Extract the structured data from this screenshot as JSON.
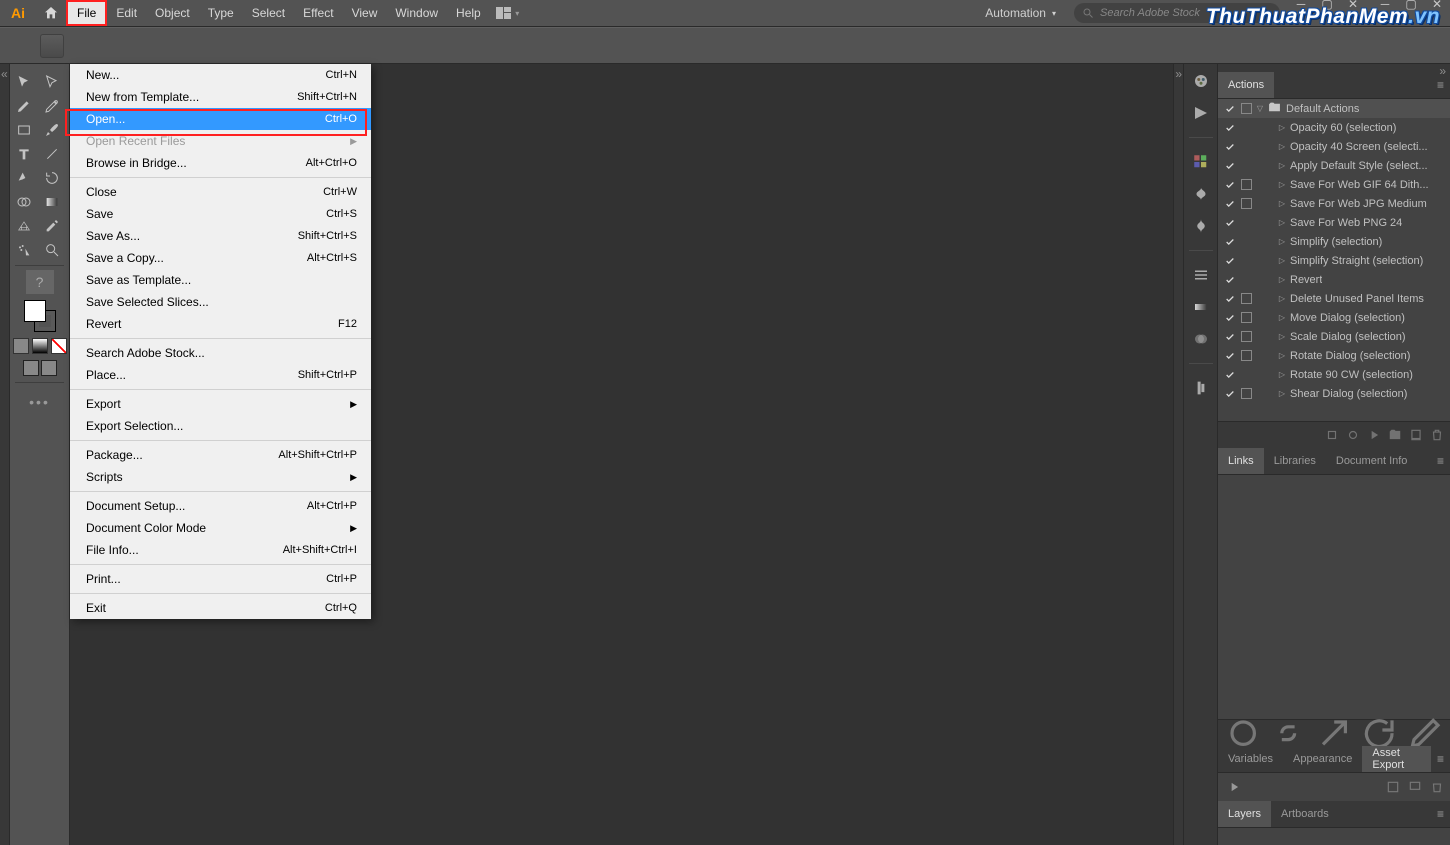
{
  "menubar": {
    "items": [
      "File",
      "Edit",
      "Object",
      "Type",
      "Select",
      "Effect",
      "View",
      "Window",
      "Help"
    ],
    "active": "File"
  },
  "workspace": {
    "label": "Automation"
  },
  "search": {
    "placeholder": "Search Adobe Stock"
  },
  "dropdown": {
    "groups": [
      [
        {
          "label": "New...",
          "shortcut": "Ctrl+N"
        },
        {
          "label": "New from Template...",
          "shortcut": "Shift+Ctrl+N"
        },
        {
          "label": "Open...",
          "shortcut": "Ctrl+O",
          "highlighted": true
        },
        {
          "label": "Open Recent Files",
          "sub": true,
          "disabled": true
        },
        {
          "label": "Browse in Bridge...",
          "shortcut": "Alt+Ctrl+O"
        }
      ],
      [
        {
          "label": "Close",
          "shortcut": "Ctrl+W"
        },
        {
          "label": "Save",
          "shortcut": "Ctrl+S"
        },
        {
          "label": "Save As...",
          "shortcut": "Shift+Ctrl+S"
        },
        {
          "label": "Save a Copy...",
          "shortcut": "Alt+Ctrl+S"
        },
        {
          "label": "Save as Template..."
        },
        {
          "label": "Save Selected Slices..."
        },
        {
          "label": "Revert",
          "shortcut": "F12"
        }
      ],
      [
        {
          "label": "Search Adobe Stock..."
        },
        {
          "label": "Place...",
          "shortcut": "Shift+Ctrl+P"
        }
      ],
      [
        {
          "label": "Export",
          "sub": true
        },
        {
          "label": "Export Selection..."
        }
      ],
      [
        {
          "label": "Package...",
          "shortcut": "Alt+Shift+Ctrl+P"
        },
        {
          "label": "Scripts",
          "sub": true
        }
      ],
      [
        {
          "label": "Document Setup...",
          "shortcut": "Alt+Ctrl+P"
        },
        {
          "label": "Document Color Mode",
          "sub": true
        },
        {
          "label": "File Info...",
          "shortcut": "Alt+Shift+Ctrl+I"
        }
      ],
      [
        {
          "label": "Print...",
          "shortcut": "Ctrl+P"
        }
      ],
      [
        {
          "label": "Exit",
          "shortcut": "Ctrl+Q"
        }
      ]
    ]
  },
  "actions_panel": {
    "tab": "Actions",
    "folder": "Default Actions",
    "items": [
      {
        "name": "Opacity 60 (selection)",
        "sq": false
      },
      {
        "name": "Opacity 40 Screen (selecti...",
        "sq": false
      },
      {
        "name": "Apply Default Style (select...",
        "sq": false
      },
      {
        "name": "Save For Web GIF 64 Dith...",
        "sq": true
      },
      {
        "name": "Save For Web JPG Medium",
        "sq": true
      },
      {
        "name": "Save For Web PNG 24",
        "sq": false
      },
      {
        "name": "Simplify (selection)",
        "sq": false
      },
      {
        "name": "Simplify Straight (selection)",
        "sq": false
      },
      {
        "name": "Revert",
        "sq": false
      },
      {
        "name": "Delete Unused Panel Items",
        "sq": true
      },
      {
        "name": "Move Dialog (selection)",
        "sq": true
      },
      {
        "name": "Scale Dialog (selection)",
        "sq": true
      },
      {
        "name": "Rotate Dialog (selection)",
        "sq": true
      },
      {
        "name": "Rotate 90 CW (selection)",
        "sq": false
      },
      {
        "name": "Shear Dialog (selection)",
        "sq": true
      }
    ]
  },
  "mid_tabs": {
    "items": [
      "Links",
      "Libraries",
      "Document Info"
    ],
    "active": "Links"
  },
  "bottom_tabs1": {
    "items": [
      "Variables",
      "Appearance",
      "Asset Export"
    ],
    "active": "Asset Export"
  },
  "bottom_tabs2": {
    "items": [
      "Layers",
      "Artboards"
    ],
    "active": "Layers"
  },
  "proxy_label": "?",
  "watermark": {
    "main": "ThuThuatPhanMem",
    "ext": ".vn"
  }
}
